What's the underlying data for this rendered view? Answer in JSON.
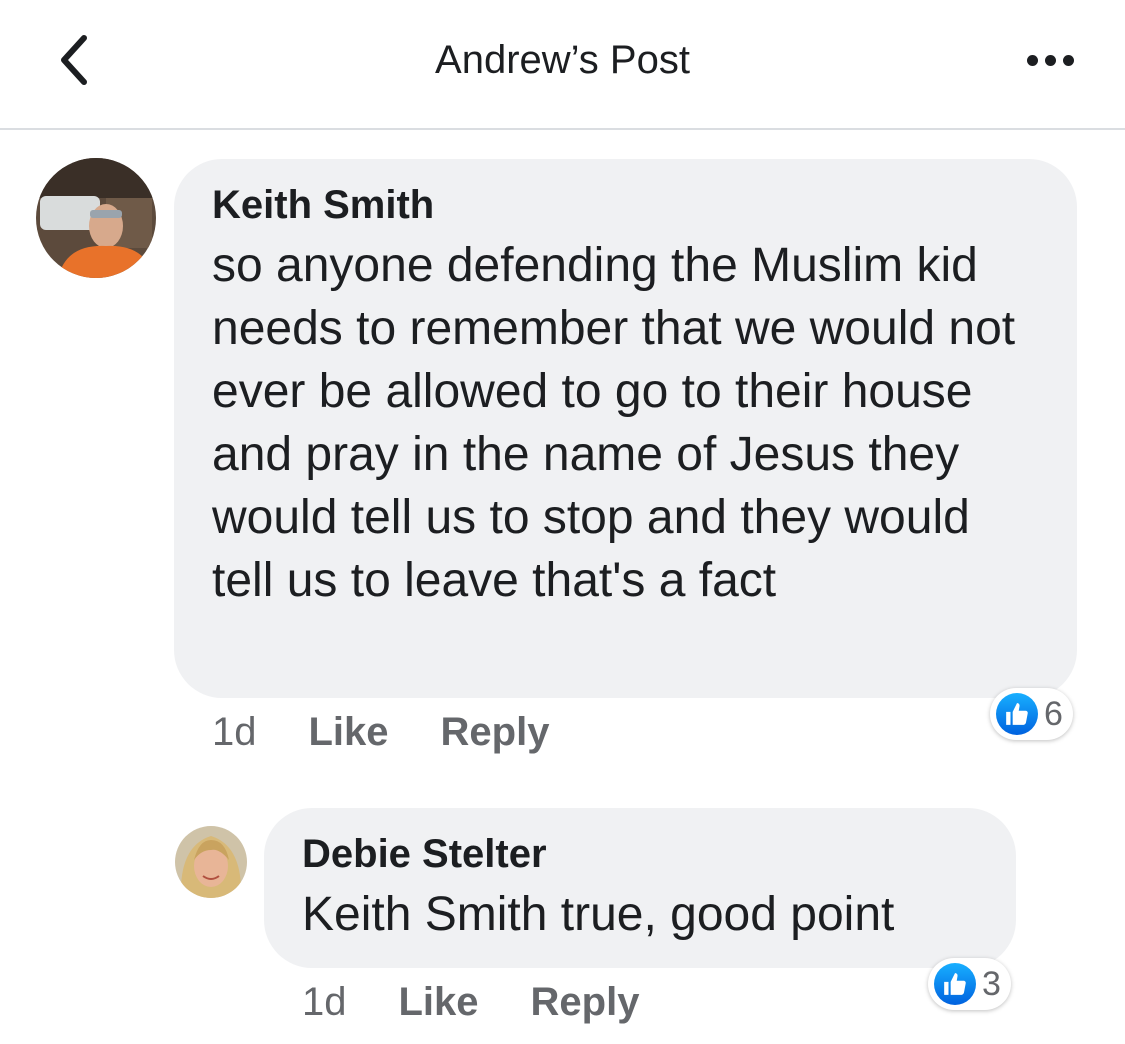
{
  "header": {
    "title": "Andrew’s Post",
    "back_icon": "chevron-left-icon",
    "more_icon": "more-horizontal-icon"
  },
  "comments": [
    {
      "author": "Keith Smith",
      "text": "so anyone defending the Muslim kid needs to remember that we would not ever be allowed to go to their house and pray in the name of Jesus they would tell us to stop and they would tell us to leave that's a fact",
      "time": "1d",
      "like_label": "Like",
      "reply_label": "Reply",
      "reaction_count": "6",
      "reaction_icon": "like-icon"
    },
    {
      "author": "Debie Stelter",
      "text": "Keith Smith true, good point",
      "time": "1d",
      "like_label": "Like",
      "reply_label": "Reply",
      "reaction_count": "3",
      "reaction_icon": "like-icon"
    }
  ],
  "colors": {
    "bubble": "#f0f1f3",
    "meta_text": "#65676b",
    "like_blue": "#1877f2"
  }
}
